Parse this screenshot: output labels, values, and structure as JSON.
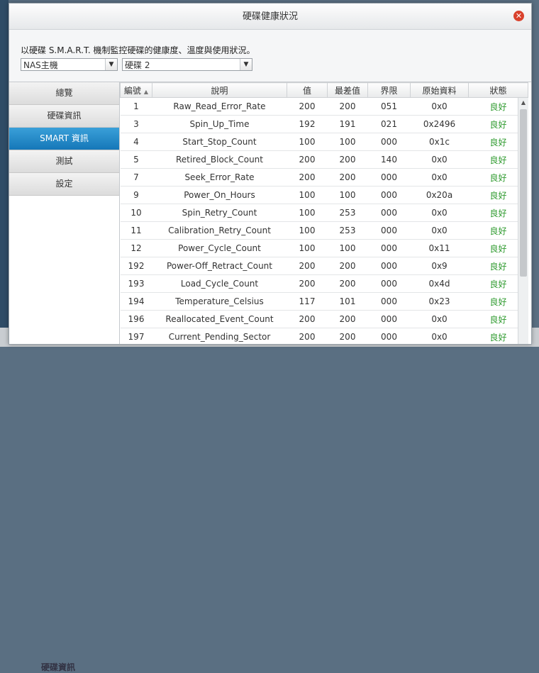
{
  "background": {
    "bottom_label": "硬碟資訊"
  },
  "dialog": {
    "title": "硬碟健康狀況",
    "close_icon": "close-icon",
    "description": "以硬碟 S.M.A.R.T. 機制監控硬碟的健康度、溫度與使用狀況。",
    "device_select": {
      "value": "NAS主機"
    },
    "disk_select": {
      "value": "硬碟 2"
    }
  },
  "sidebar": {
    "items": [
      {
        "label": "總覽"
      },
      {
        "label": "硬碟資訊"
      },
      {
        "label": "SMART 資訊"
      },
      {
        "label": "測試"
      },
      {
        "label": "設定"
      }
    ]
  },
  "table": {
    "headers": [
      "編號",
      "說明",
      "值",
      "最差值",
      "界限",
      "原始資料",
      "狀態"
    ],
    "rows": [
      [
        "1",
        "Raw_Read_Error_Rate",
        "200",
        "200",
        "051",
        "0x0",
        "良好"
      ],
      [
        "3",
        "Spin_Up_Time",
        "192",
        "191",
        "021",
        "0x2496",
        "良好"
      ],
      [
        "4",
        "Start_Stop_Count",
        "100",
        "100",
        "000",
        "0x1c",
        "良好"
      ],
      [
        "5",
        "Retired_Block_Count",
        "200",
        "200",
        "140",
        "0x0",
        "良好"
      ],
      [
        "7",
        "Seek_Error_Rate",
        "200",
        "200",
        "000",
        "0x0",
        "良好"
      ],
      [
        "9",
        "Power_On_Hours",
        "100",
        "100",
        "000",
        "0x20a",
        "良好"
      ],
      [
        "10",
        "Spin_Retry_Count",
        "100",
        "253",
        "000",
        "0x0",
        "良好"
      ],
      [
        "11",
        "Calibration_Retry_Count",
        "100",
        "253",
        "000",
        "0x0",
        "良好"
      ],
      [
        "12",
        "Power_Cycle_Count",
        "100",
        "100",
        "000",
        "0x11",
        "良好"
      ],
      [
        "192",
        "Power-Off_Retract_Count",
        "200",
        "200",
        "000",
        "0x9",
        "良好"
      ],
      [
        "193",
        "Load_Cycle_Count",
        "200",
        "200",
        "000",
        "0x4d",
        "良好"
      ],
      [
        "194",
        "Temperature_Celsius",
        "117",
        "101",
        "000",
        "0x23",
        "良好"
      ],
      [
        "196",
        "Reallocated_Event_Count",
        "200",
        "200",
        "000",
        "0x0",
        "良好"
      ],
      [
        "197",
        "Current_Pending_Sector",
        "200",
        "200",
        "000",
        "0x0",
        "良好"
      ]
    ]
  },
  "colors": {
    "accent": "#1b86c6",
    "status_good": "#2e9a2e",
    "close": "#d9412c"
  }
}
